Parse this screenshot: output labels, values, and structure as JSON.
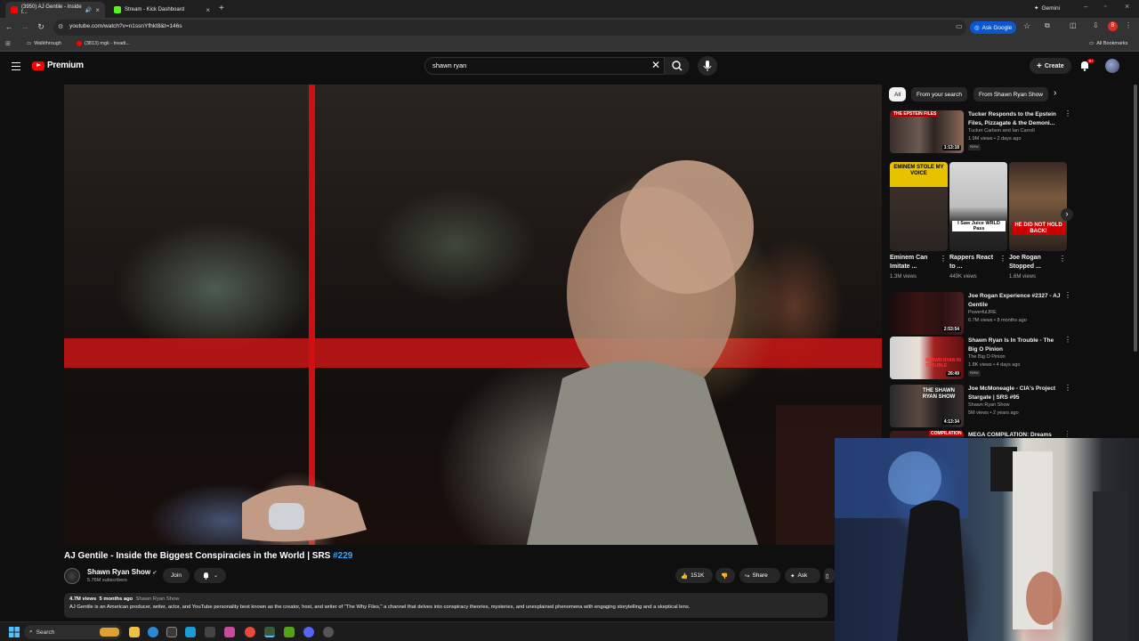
{
  "browser": {
    "tabs": [
      {
        "label": "(3950) AJ Gentile - Inside t...",
        "active": true,
        "favicon_color": "#ff0000"
      },
      {
        "label": "Stream - Kick Dashboard",
        "active": false,
        "favicon_color": "#53fc18"
      }
    ],
    "gemini_label": "Gemini",
    "url": "youtube.com/watch?v=n1ssnYfhkt8&t=146s",
    "ask_google_label": "Ask Google",
    "bookmarks": [
      {
        "label": "Walkthrough"
      },
      {
        "label": "(3813) mgk - treadi..."
      }
    ],
    "all_bookmarks_label": "All Bookmarks",
    "profile_initial": "B"
  },
  "header": {
    "logo_text": "Premium",
    "search_value": "shawn ryan",
    "create_label": "Create",
    "notification_count": "9+"
  },
  "video": {
    "title": "AJ Gentile - Inside the Biggest Conspiracies in the World | SRS ",
    "title_tag": "#229",
    "channel_name": "Shawn Ryan Show",
    "subscribers": "5.76M subscribers",
    "join_label": "Join",
    "likes": "151K",
    "share_label": "Share",
    "ask_label": "Ask",
    "views": "4.7M views",
    "age": "5 months ago",
    "desc_channel": "Shawn Ryan Show",
    "description": "AJ Gentile is an American producer, writer, actor, and YouTube personality best known as the creator, host, and writer of \"The Why Files,\" a channel that delves into conspiracy theories, mysteries, and unexplained phenomena with engaging storytelling and a skeptical lens."
  },
  "sidebar": {
    "chips": [
      {
        "label": "All",
        "active": true
      },
      {
        "label": "From your search",
        "active": false
      },
      {
        "label": "From Shawn Ryan Show",
        "active": false
      }
    ],
    "recommendations": [
      {
        "title": "Tucker Responds to the Epstein Files, Pizzagate & the Demoni...",
        "channel": "Tucker Carlson and Ian Carroll",
        "views": "1.9M views • 2 days ago",
        "new": "New",
        "duration": "1:13:18",
        "thumb_overlay": "THE EPSTEIN FILES"
      },
      {
        "title": "Joe Rogan Experience #2327 - AJ Gentile",
        "channel": "PowerfulJRE",
        "views": "6.7M views • 8 months ago",
        "new": "",
        "duration": "2:53:54",
        "thumb_overlay": ""
      },
      {
        "title": "Shawn Ryan Is In Trouble - The Big O Pinion",
        "channel": "The Big O Pinion",
        "views": "1.8K views • 4 days ago",
        "new": "New",
        "duration": "26:49",
        "thumb_overlay": "SHAWN RYAN IN TROUBLE"
      },
      {
        "title": "Joe McMoneagle - CIA's Project Stargate | SRS #95",
        "channel": "Shawn Ryan Show",
        "views": "5M views • 2 years ago",
        "new": "",
        "duration": "4:13:34",
        "thumb_overlay": "THE SHAWN RYAN SHOW"
      },
      {
        "title": "MEGA COMPILATION: Dreams",
        "channel": "",
        "views": "",
        "new": "",
        "duration": "",
        "thumb_overlay": "COMPILATION"
      }
    ],
    "shorts": [
      {
        "title": "Eminem Can Imitate ...",
        "views": "1.3M views",
        "thumb_text": "EMINEM STOLE MY VOICE"
      },
      {
        "title": "Rappers React to ...",
        "views": "449K views",
        "thumb_text": "I Saw Juice WRLD Pass"
      },
      {
        "title": "Joe Rogan Stopped ...",
        "views": "1.6M views",
        "thumb_text": "HE DID NOT HOLD BACK!"
      }
    ]
  },
  "taskbar": {
    "search_label": "Search"
  },
  "colors": {
    "accent_red": "#ff0000",
    "link_blue": "#3ea6ff",
    "bg": "#0f0f0f"
  }
}
